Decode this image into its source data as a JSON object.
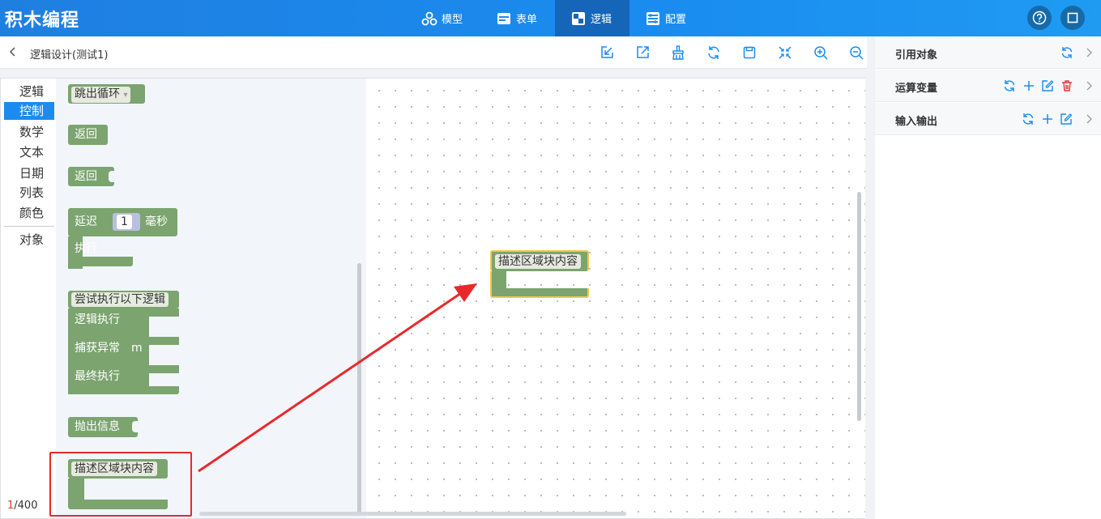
{
  "app": {
    "title": "积木编程"
  },
  "nav": {
    "tabs": [
      {
        "label": "模型",
        "icon": "cluster-icon"
      },
      {
        "label": "表单",
        "icon": "form-icon"
      },
      {
        "label": "逻辑",
        "icon": "logic-icon",
        "active": true
      },
      {
        "label": "配置",
        "icon": "config-icon"
      }
    ]
  },
  "header_icons": [
    "help-icon",
    "fullscreen-icon"
  ],
  "breadcrumb": {
    "back_icon": "chevron-left-icon",
    "title": "逻辑设计(测试1)"
  },
  "toolbar": {
    "icons": [
      "import-icon",
      "export-icon",
      "clean-icon",
      "refresh-icon",
      "save-icon",
      "center-icon",
      "zoom-in-icon",
      "zoom-out-icon"
    ]
  },
  "categories": {
    "items": [
      {
        "label": "逻辑"
      },
      {
        "label": "控制",
        "active": true
      },
      {
        "label": "数学"
      },
      {
        "label": "文本"
      },
      {
        "label": "日期"
      },
      {
        "label": "列表"
      },
      {
        "label": "颜色"
      },
      {
        "label": "对象"
      }
    ],
    "counter_current": "1",
    "counter_total": "/400"
  },
  "flyout": {
    "break_loop": {
      "label": "跳出循环",
      "dropdown": "▾"
    },
    "return1": {
      "label": "返回"
    },
    "return2": {
      "label": "返回"
    },
    "delay": {
      "label": "延迟",
      "value": "1",
      "unit": "毫秒",
      "do": "执行"
    },
    "try": {
      "label": "尝试执行以下逻辑",
      "logic": "逻辑执行",
      "catch": "捕获异常",
      "var": "m",
      "finally": "最终执行"
    },
    "throw": {
      "label": "抛出信息"
    },
    "desc": {
      "label": "描述区域块内容"
    }
  },
  "workspace": {
    "block_label": "描述区域块内容"
  },
  "right_panel": {
    "rows": [
      {
        "label": "引用对象",
        "icons": [
          "refresh-icon",
          "chevron-right-icon"
        ]
      },
      {
        "label": "运算变量",
        "icons": [
          "refresh-icon",
          "plus-icon",
          "edit-icon",
          "delete-icon",
          "chevron-right-icon"
        ]
      },
      {
        "label": "输入输出",
        "icons": [
          "refresh-icon",
          "plus-icon",
          "edit-icon",
          "chevron-right-icon"
        ]
      }
    ]
  },
  "colors": {
    "primary": "#1a8cf0",
    "block_green": "#7ba46f",
    "highlight_red": "#e8292c",
    "selected_outline": "#f2c94c"
  }
}
